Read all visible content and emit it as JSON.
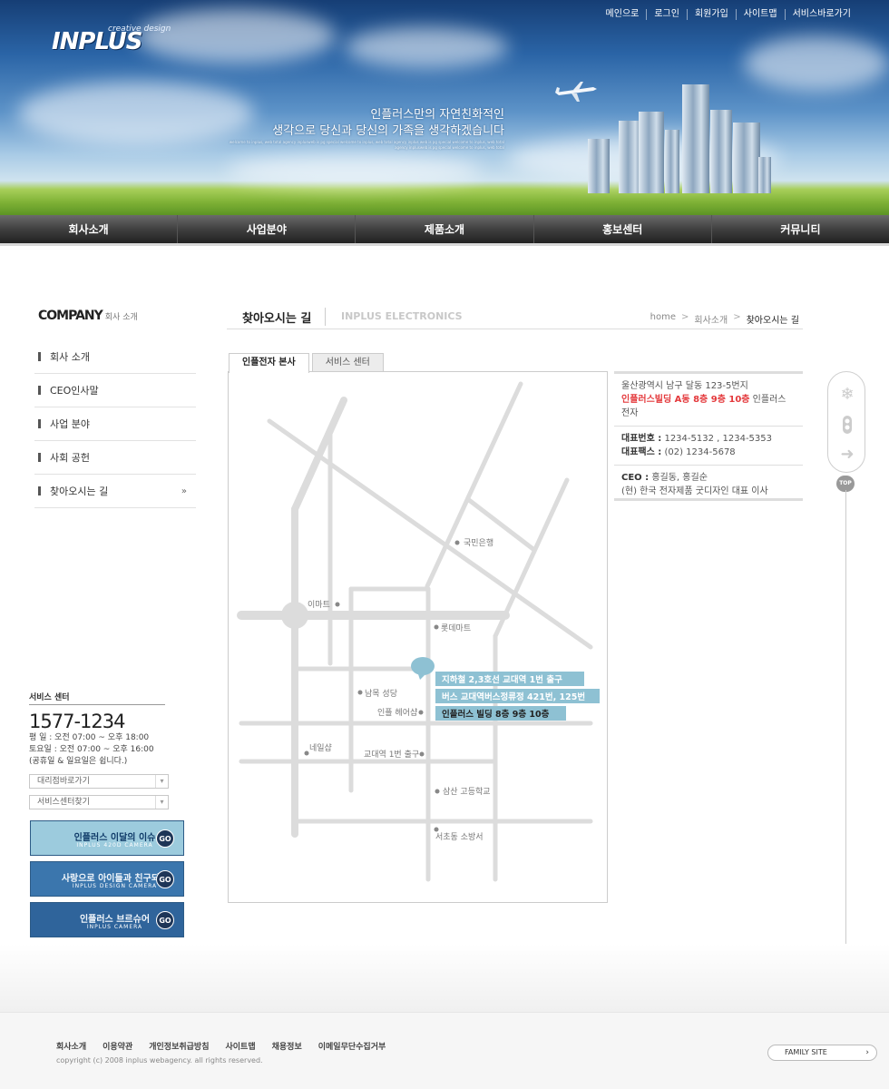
{
  "header": {
    "logo_text": "INPLUS",
    "logo_sub": "creative design",
    "top_links": [
      "메인으로",
      "로그인",
      "회원가입",
      "사이트맵",
      "서비스바로가기"
    ],
    "slogan_line1": "인플러스만의 자연친화적인",
    "slogan_line2": "생각으로 당신과 당신의 가족을 생각하겠습니다",
    "slogan_small": "welcome to inplus, web total agency inplusweb is pg special welcome to inplus, web total agency inplus web is pg special welcome to inplus, web total agency inplusweb is pg special welcome to inplus, web total"
  },
  "gnb": [
    "회사소개",
    "사업분야",
    "제품소개",
    "홍보센터",
    "커뮤니티"
  ],
  "lnb": {
    "title_en": "COMPANY",
    "title_ko": "회사 소개",
    "items": [
      "회사 소개",
      "CEO인사말",
      "사업 분야",
      "사회 공헌",
      "찾아오시는 길"
    ],
    "active_arrow": "»"
  },
  "service": {
    "title": "서비스 센터",
    "phone": "1577-1234",
    "hours": [
      "평    일 : 오전 07:00 ~ 오후 18:00",
      "토요일 : 오전 07:00 ~ 오후 16:00",
      "(공휴일 & 일요일은 쉽니다.)"
    ],
    "select1": "대리점바로가기",
    "select2": "서비스센터찾기"
  },
  "banners": [
    {
      "title": "인플러스 이달의 이슈",
      "sub": "INPLUS 420D CAMERA",
      "go": "GO",
      "bg": "#9ccbdd",
      "fg": "#0f3a68"
    },
    {
      "title": "사랑으로 아이들과 친구되기",
      "sub": "INPLUS DESIGN CAMERA",
      "go": "GO",
      "bg": "#3b76ad",
      "fg": "#f2f7fb"
    },
    {
      "title": "인플러스 브르슈어",
      "sub": "INPLUS CAMERA",
      "go": "GO",
      "bg": "#2f649b",
      "fg": "#f2f7fb"
    }
  ],
  "page": {
    "title": "찾아오시는 길",
    "title_en": "INPLUS ELECTRONICS",
    "breadcrumb": [
      "home",
      "회사소개",
      "찾아오시는 길"
    ],
    "sep": ">"
  },
  "tabs": [
    "인플전자 본사",
    "서비스 센터"
  ],
  "map": {
    "labels": {
      "kookmin": "국민은행",
      "emart": "이마트",
      "lotte": "롯데마트",
      "church": "남목 성당",
      "hair": "인플 헤어샵",
      "nail": "네일샵",
      "exit": "교대역 1번 출구",
      "school": "삼산 고등학교",
      "fire": "서초동 소방서"
    },
    "directions": [
      "지하철 2,3호선 교대역 1번 출구",
      "버스 교대역버스정류정 421번, 125번",
      "인플러스 빌딩 8층 9층 10층"
    ],
    "road_color": "#dcdcdc",
    "callout_color": "#8ec1d3"
  },
  "info": {
    "address": "울산광역시 남구 달동 123-5번지",
    "building_red": "인플러스빌딩  A동 8층 9층 10층",
    "building_rest": " 인플러스 전자",
    "tel_label": "대표번호 :",
    "tel": " 1234-5132 , 1234-5353",
    "fax_label": "대표팩스 :",
    "fax": " (02) 1234-5678",
    "ceo_label": "CEO :",
    "ceo": " 홍길동, 홍길순",
    "ceo_desc": "(현) 한국 전자제품 굿디자인 대표 이사"
  },
  "quick": {
    "top": "TOP"
  },
  "footer": {
    "links": [
      "회사소개",
      "이용약관",
      "개인정보취급방침",
      "사이트맵",
      "채용정보",
      "이메일무단수집거부"
    ],
    "copyright": "copyright (c) 2008 inplus webagency.  all rights reserved.",
    "family": "FAMILY SITE",
    "family_arrow": "›"
  }
}
